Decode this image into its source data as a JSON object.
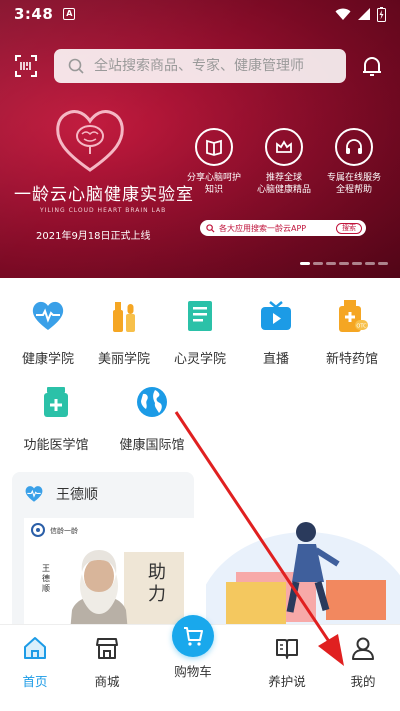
{
  "status_bar": {
    "time": "3:48",
    "badge": "A"
  },
  "header": {
    "search_placeholder": "全站搜索商品、专家、健康管理师"
  },
  "banner": {
    "brand_title": "一龄云心脑健康实验室",
    "brand_subtitle": "YILING CLOUD HEART BRAIN LAB",
    "launch_date": "2021年9月18日正式上线",
    "features": [
      {
        "icon": "book-icon",
        "label": "分享心脑呵护\n知识"
      },
      {
        "icon": "crown-icon",
        "label": "推荐全球\n心脑健康精品"
      },
      {
        "icon": "headset-icon",
        "label": "专属在线服务\n全程帮助"
      }
    ],
    "app_search_text": "各大应用搜索一龄云APP",
    "app_search_button": "搜索"
  },
  "categories": [
    {
      "label": "健康学院",
      "icon": "heartbeat-icon"
    },
    {
      "label": "美丽学院",
      "icon": "cosmetics-icon"
    },
    {
      "label": "心灵学院",
      "icon": "notebook-icon"
    },
    {
      "label": "直播",
      "icon": "tv-icon"
    },
    {
      "label": "新特药馆",
      "icon": "medicine-bottle-icon"
    },
    {
      "label": "功能医学馆",
      "icon": "medical-jar-icon"
    },
    {
      "label": "健康国际馆",
      "icon": "globe-icon"
    }
  ],
  "expert_card": {
    "name": "王德顺",
    "book_logo": "信龄一龄",
    "vertical_text": "王德顺",
    "calligraphy": "助力"
  },
  "bottom_nav": {
    "home": "首页",
    "mall": "商城",
    "cart": "购物车",
    "care": "养护说",
    "mine": "我的"
  },
  "colors": {
    "accent_blue": "#1c9be6",
    "banner_red": "#9e1131",
    "arrow_red": "#e02020"
  }
}
